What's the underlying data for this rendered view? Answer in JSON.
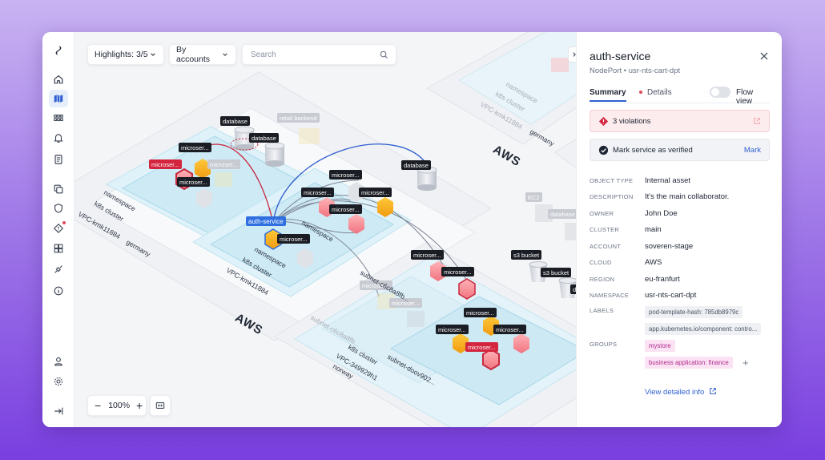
{
  "toolbar": {
    "highlights": "Highlights: 3/5",
    "group_by": "By accounts",
    "search_placeholder": "Search"
  },
  "zoom": {
    "level": "100%"
  },
  "map": {
    "cloud_labels": [
      "AWS",
      "AWS"
    ],
    "regions": [
      "germany",
      "germany",
      "norway"
    ],
    "clusters": [
      "k8s cluster",
      "k8s cluster",
      "k8s cluster",
      "k8s cluster"
    ],
    "vpcs": [
      "VPC-kmk11884",
      "VPC-kmk11884",
      "VPC-kmk11884",
      "VPC-349929h1"
    ],
    "namespaces": [
      "namespace",
      "namespace",
      "namespace",
      "namespace"
    ],
    "subnets": [
      "subnet-c6c8a8fb...",
      "subnet-c6c8a8fb...",
      "subnet-doov902..."
    ],
    "node_labels": {
      "database": "database",
      "retail_backend": "retail backend",
      "microservice": "microser...",
      "auth_service": "auth-service",
      "s3_bucket": "s3 bucket",
      "ec2": "EC2"
    }
  },
  "panel": {
    "title": "auth-service",
    "subtitle": "NodePort • usr-nts-cart-dpt",
    "tabs": {
      "summary": "Summary",
      "details": "Details"
    },
    "flow_view": "Flow view",
    "violations": "3 violations",
    "verify_text": "Mark service as verified",
    "verify_action": "Mark",
    "properties": [
      {
        "key": "OBJECT TYPE",
        "value": "Internal asset"
      },
      {
        "key": "DESCRIPTION",
        "value": "It's the main collaborator."
      },
      {
        "key": "OWNER",
        "value": "John Doe"
      },
      {
        "key": "CLUSTER",
        "value": "main"
      },
      {
        "key": "ACCOUNT",
        "value": "soveren-stage"
      },
      {
        "key": "CLOUD",
        "value": "AWS"
      },
      {
        "key": "REGION",
        "value": "eu-franfurt"
      },
      {
        "key": "NAMESPACE",
        "value": "usr-nts-cart-dpt"
      }
    ],
    "labels_key": "LABELS",
    "labels": [
      "pod-template-hash: 785db8979c",
      "app.kubernetes.io/component: contro..."
    ],
    "groups_key": "GROUPS",
    "groups": [
      "mystore",
      "business application: finance"
    ],
    "detail_link": "View detailed info"
  }
}
